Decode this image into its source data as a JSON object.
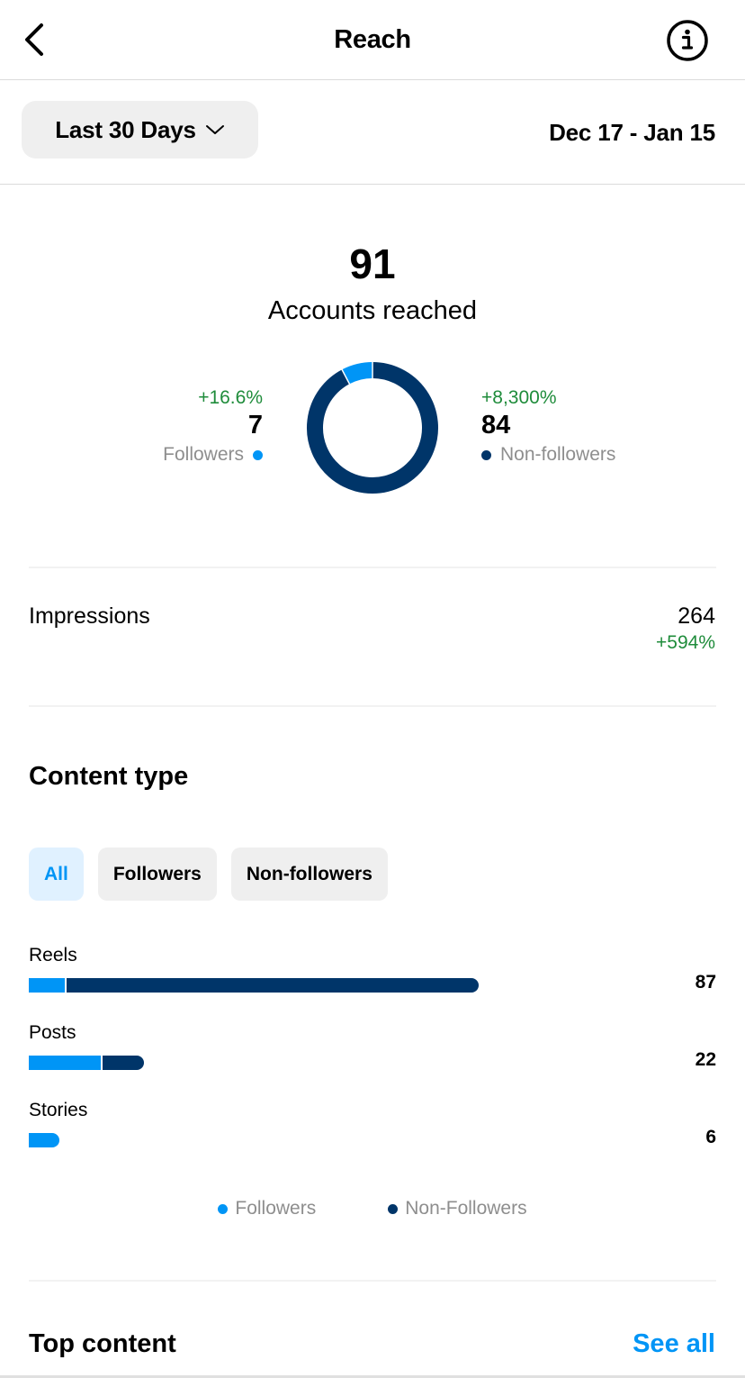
{
  "header": {
    "title": "Reach",
    "back_icon": "chevron-left-icon",
    "info_icon": "info-circle-icon"
  },
  "filter": {
    "period_label": "Last 30 Days",
    "period_icon": "chevron-down-icon",
    "date_range": "Dec 17 - Jan 15"
  },
  "colors": {
    "followers": "#0095F6",
    "non_followers": "#003569",
    "positive": "#1F8C3B",
    "accent": "#0095F6"
  },
  "reach": {
    "total": "91",
    "label": "Accounts reached",
    "followers": {
      "change": "+16.6%",
      "value": "7",
      "label": "Followers"
    },
    "non_followers": {
      "change": "+8,300%",
      "value": "84",
      "label": "Non-followers"
    }
  },
  "impressions": {
    "label": "Impressions",
    "value": "264",
    "change": "+594%"
  },
  "content_type": {
    "title": "Content type",
    "chips": [
      {
        "label": "All",
        "active": true
      },
      {
        "label": "Followers",
        "active": false
      },
      {
        "label": "Non-followers",
        "active": false
      }
    ],
    "legend": {
      "followers": "Followers",
      "non_followers": "Non-Followers"
    }
  },
  "top_content": {
    "title": "Top content",
    "see_all": "See all"
  },
  "chart_data": [
    {
      "type": "pie",
      "title": "Accounts reached",
      "categories": [
        "Followers",
        "Non-followers"
      ],
      "values": [
        7,
        84
      ],
      "total": 91,
      "style": "donut"
    },
    {
      "type": "bar",
      "orientation": "horizontal",
      "stacked": true,
      "title": "Content type",
      "categories": [
        "Reels",
        "Posts",
        "Stories"
      ],
      "totals": [
        87,
        22,
        6
      ],
      "series": [
        {
          "name": "Followers",
          "values": [
            7,
            14,
            6
          ]
        },
        {
          "name": "Non-Followers",
          "values": [
            80,
            8,
            0
          ]
        }
      ],
      "legend": "bottom-center"
    }
  ]
}
